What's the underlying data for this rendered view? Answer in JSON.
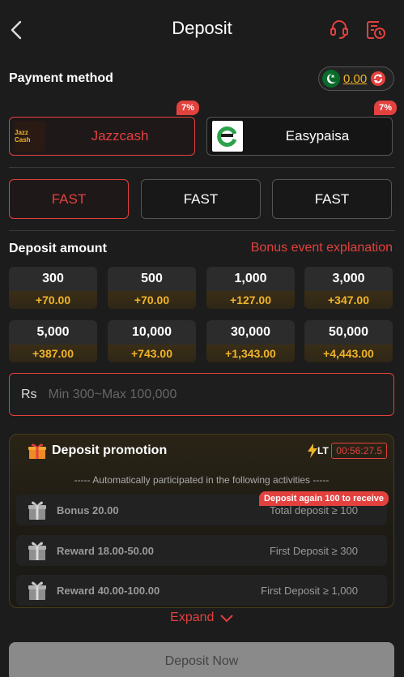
{
  "header": {
    "title": "Deposit"
  },
  "payment": {
    "label": "Payment method",
    "balance": "0.00",
    "methods": [
      {
        "name": "Jazzcash",
        "badge": "7%",
        "logo_text": "Jazz Cash"
      },
      {
        "name": "Easypaisa",
        "badge": "7%"
      }
    ]
  },
  "channels": [
    "FAST",
    "FAST",
    "FAST"
  ],
  "deposit": {
    "label": "Deposit amount",
    "bonus_link": "Bonus event explanation",
    "amounts": [
      {
        "amount": "300",
        "bonus": "+70.00"
      },
      {
        "amount": "500",
        "bonus": "+70.00"
      },
      {
        "amount": "1,000",
        "bonus": "+127.00"
      },
      {
        "amount": "3,000",
        "bonus": "+347.00"
      },
      {
        "amount": "5,000",
        "bonus": "+387.00"
      },
      {
        "amount": "10,000",
        "bonus": "+743.00"
      },
      {
        "amount": "30,000",
        "bonus": "+1,343.00"
      },
      {
        "amount": "50,000",
        "bonus": "+4,443.00"
      }
    ],
    "currency": "Rs",
    "placeholder": "Min 300~Max 100,000"
  },
  "promotion": {
    "title": "Deposit promotion",
    "lt_label": "LT",
    "timer": "00:56:27.5",
    "auto_text": "----- Automatically participated in the following activities -----",
    "receive_tip": "Deposit again 100 to receive",
    "activities": [
      {
        "name": "Bonus 20.00",
        "condition": "Total deposit ≥ 100"
      },
      {
        "name": "Reward 18.00-50.00",
        "condition": "First Deposit ≥ 300"
      },
      {
        "name": "Reward 40.00-100.00",
        "condition": "First Deposit ≥ 1,000"
      }
    ],
    "expand_label": "Expand"
  },
  "submit_label": "Deposit Now",
  "colors": {
    "accent": "#e2413e",
    "gold": "#f0b429",
    "background": "#1c1c1c"
  }
}
